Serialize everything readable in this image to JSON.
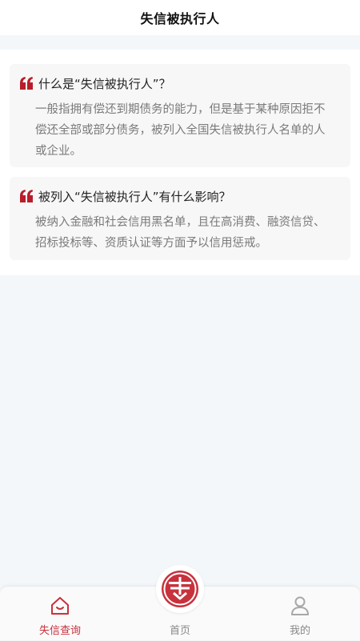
{
  "header": {
    "title": "失信被执行人"
  },
  "faq": [
    {
      "question": "什么是“失信被执行人”？",
      "answer": "一般指拥有偿还到期债务的能力，但是基于某种原因拒不偿还全部或部分债务，被列入全国失信被执行人名单的人或企业。"
    },
    {
      "question": "被列入“失信被执行人”有什么影响？",
      "answer": "被纳入金融和社会信用黑名单，且在高消费、融资信贷、招标投标等、资质认证等方面予以信用惩戒。"
    }
  ],
  "tabbar": {
    "items": [
      {
        "label": "失信查询",
        "icon": "house-icon",
        "active": true
      },
      {
        "label": "首页",
        "icon": "logo-seal-icon",
        "active": false
      },
      {
        "label": "我的",
        "icon": "person-icon",
        "active": false
      }
    ]
  },
  "colors": {
    "accent": "#c8323d",
    "quote": "#b81e2a",
    "muted": "#888888"
  }
}
